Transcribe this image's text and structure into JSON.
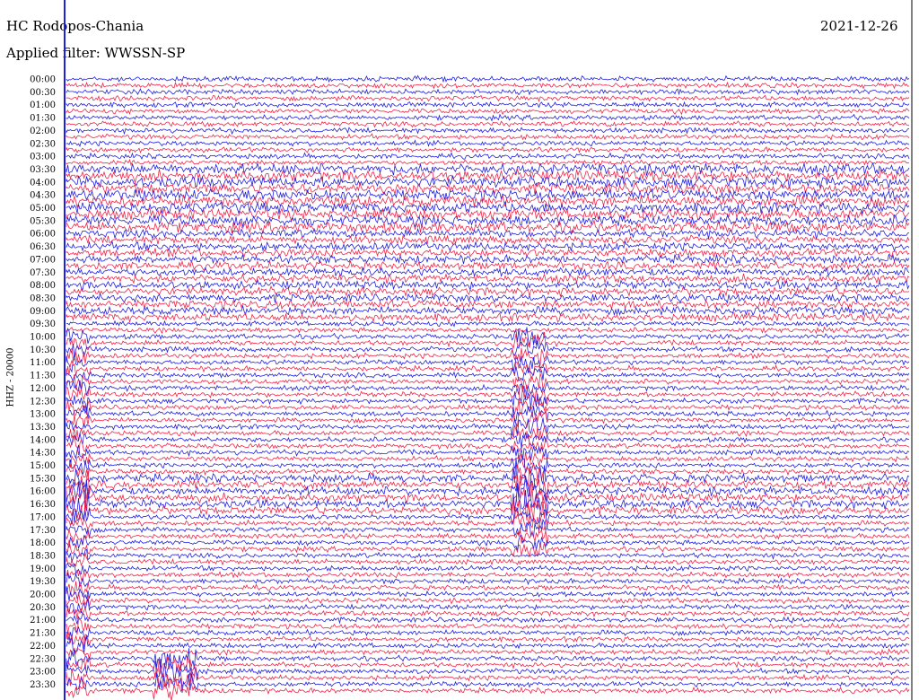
{
  "header": {
    "station": "HC Rodopos-Chania",
    "filter": "Applied filter: WWSSN-SP",
    "date": "2021-12-26"
  },
  "chart_data": {
    "type": "line",
    "title": "HC Rodopos-Chania",
    "subtitle": "Applied filter: WWSSN-SP",
    "ylabel": "HHZ - 20000",
    "tick_labels": [
      "00:00",
      "00:30",
      "01:00",
      "01:30",
      "02:00",
      "02:30",
      "03:00",
      "03:30",
      "04:00",
      "04:30",
      "05:00",
      "05:30",
      "06:00",
      "06:30",
      "07:00",
      "07:30",
      "08:00",
      "08:30",
      "09:00",
      "09:30",
      "10:00",
      "10:30",
      "11:00",
      "11:30",
      "12:00",
      "12:30",
      "13:00",
      "13:30",
      "14:00",
      "14:30",
      "15:00",
      "15:30",
      "16:00",
      "16:30",
      "17:00",
      "17:30",
      "18:00",
      "18:30",
      "19:00",
      "19:30",
      "20:00",
      "20:30",
      "21:00",
      "21:30",
      "22:00",
      "22:30",
      "23:00",
      "23:30"
    ],
    "trace_colors": [
      "#1f1fe0",
      "#f02448"
    ],
    "grid": false
  }
}
